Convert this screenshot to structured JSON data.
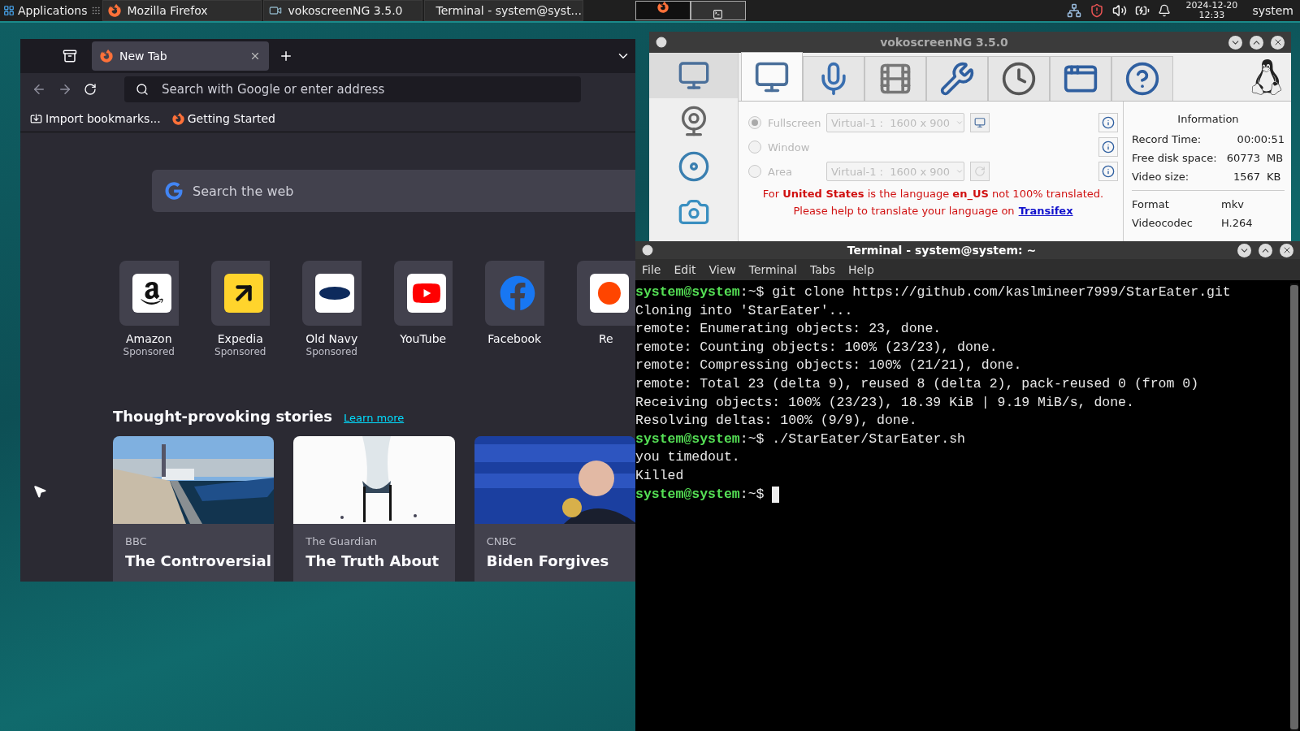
{
  "taskbar": {
    "menu": "Applications",
    "tasks": [
      {
        "label": "Mozilla Firefox",
        "kind": "firefox"
      },
      {
        "label": "vokoscreenNG 3.5.0",
        "kind": "recorder"
      },
      {
        "label": "Terminal - system@syst...",
        "kind": "terminal"
      }
    ],
    "clock": {
      "date": "2024-12-20",
      "time": "12:33"
    },
    "user": "system"
  },
  "firefox": {
    "tab": {
      "title": "New Tab",
      "selected": true
    },
    "address": {
      "placeholder": "Search with Google or enter address"
    },
    "bookmarks": [
      {
        "label": "Import bookmarks...",
        "kind": "import"
      },
      {
        "label": "Getting Started",
        "kind": "firefox"
      }
    ],
    "search": {
      "placeholder": "Search the web"
    },
    "shortcuts": [
      {
        "label": "Amazon",
        "note": "Sponsored",
        "kind": "amazon"
      },
      {
        "label": "Expedia",
        "note": "Sponsored",
        "kind": "expedia"
      },
      {
        "label": "Old Navy",
        "note": "Sponsored",
        "kind": "oldnavy"
      },
      {
        "label": "YouTube",
        "kind": "youtube"
      },
      {
        "label": "Facebook",
        "kind": "facebook"
      },
      {
        "label": "Re",
        "kind": "other"
      }
    ],
    "stories": {
      "title": "Thought-provoking stories",
      "link": "Learn more",
      "items": [
        {
          "source": "BBC",
          "headline": "The Controversial"
        },
        {
          "source": "The Guardian",
          "headline": "The Truth About"
        },
        {
          "source": "CNBC",
          "headline": "Biden Forgives"
        }
      ]
    }
  },
  "vokoscreen": {
    "title": "vokoscreenNG 3.5.0",
    "sidebar": [
      {
        "kind": "screen",
        "selected": true
      },
      {
        "kind": "webcam",
        "selected": false
      },
      {
        "kind": "player",
        "selected": false
      },
      {
        "kind": "snapshot",
        "selected": false
      }
    ],
    "tabs": [
      {
        "kind": "screen",
        "selected": true
      },
      {
        "kind": "audio",
        "selected": false
      },
      {
        "kind": "codec",
        "selected": false
      },
      {
        "kind": "tools",
        "selected": false
      },
      {
        "kind": "timer",
        "selected": false
      },
      {
        "kind": "windows",
        "selected": false
      },
      {
        "kind": "help",
        "selected": false
      }
    ],
    "modes": [
      {
        "label": "Fullscreen",
        "selected": true,
        "disabled": true,
        "screen": "Virtual-1 :  1600 x 900"
      },
      {
        "label": "Window",
        "selected": false,
        "disabled": true
      },
      {
        "label": "Area",
        "selected": false,
        "disabled": true,
        "screen": "Virtual-1 :  1600 x 900"
      }
    ],
    "notice": "For **United States** is the language **en_US** not 100% translated.",
    "notice_help": "Please help to translate your language on",
    "notice_link": "Transifex",
    "info": {
      "title": "Information",
      "rows": [
        {
          "label": "Record Time:",
          "value": "00:00:51"
        },
        {
          "label": "Free disk space:",
          "value": "60773",
          "unit": "MB"
        },
        {
          "label": "Video size:",
          "value": "1567",
          "unit": "KB"
        }
      ],
      "details": [
        {
          "label": "Format",
          "value": "mkv"
        },
        {
          "label": "Videocodec",
          "value": "H.264"
        }
      ]
    }
  },
  "terminal": {
    "title": "Terminal - system@system: ~",
    "menu": [
      "File",
      "Edit",
      "View",
      "Terminal",
      "Tabs",
      "Help"
    ],
    "lines": [
      {
        "kind": "prompt",
        "user": "system@system",
        "path": ":~$",
        "command": "git clone https://github.com/kaslmineer7999/StarEater.git"
      },
      {
        "kind": "output",
        "text": "Cloning into 'StarEater'..."
      },
      {
        "kind": "output",
        "text": "remote: Enumerating objects: 23, done."
      },
      {
        "kind": "output",
        "text": "remote: Counting objects: 100% (23/23), done."
      },
      {
        "kind": "output",
        "text": "remote: Compressing objects: 100% (21/21), done."
      },
      {
        "kind": "output",
        "text": "remote: Total 23 (delta 9), reused 8 (delta 2), pack-reused 0 (from 0)"
      },
      {
        "kind": "output",
        "text": "Receiving objects: 100% (23/23), 18.39 KiB | 9.19 MiB/s, done."
      },
      {
        "kind": "output",
        "text": "Resolving deltas: 100% (9/9), done."
      },
      {
        "kind": "prompt",
        "user": "system@system",
        "path": ":~$",
        "command": "./StarEater/StarEater.sh"
      },
      {
        "kind": "output",
        "text": "you timedout."
      },
      {
        "kind": "output",
        "text": "Killed"
      },
      {
        "kind": "prompt",
        "user": "system@system",
        "path": ":~$",
        "cursor": true
      }
    ]
  }
}
